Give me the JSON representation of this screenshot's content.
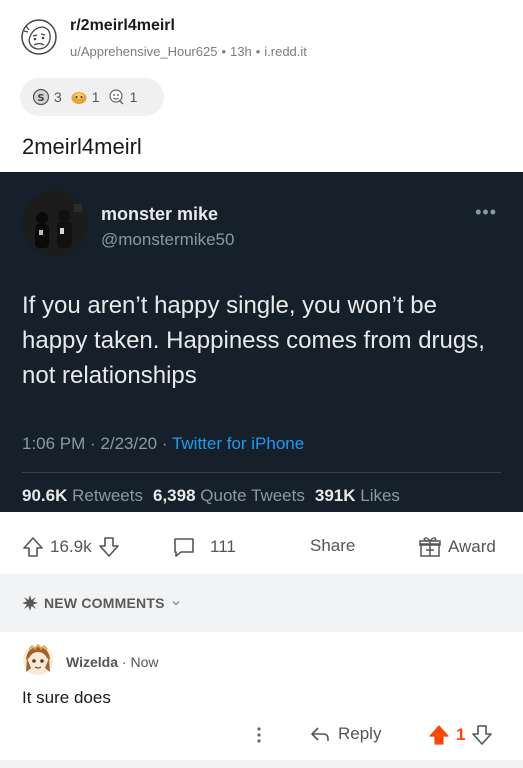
{
  "post": {
    "subreddit": "r/2meirl4meirl",
    "author": "u/Apprehensive_Hour625",
    "time": "13h",
    "domain": "i.redd.it",
    "awards": [
      {
        "icon": "silver-award-icon",
        "count": "3"
      },
      {
        "icon": "helpful-award-icon",
        "count": "1"
      },
      {
        "icon": "wholesome-award-icon",
        "count": "1"
      }
    ],
    "title": "2meirl4meirl"
  },
  "tweet": {
    "name": "monster mike",
    "handle": "@monstermike50",
    "more": "•••",
    "text": "If you aren’t happy single, you won’t be happy taken. Happiness comes from drugs, not relationships",
    "time": "1:06 PM · 2/23/20 · ",
    "source": "Twitter for iPhone",
    "retweets_count": "90.6K",
    "retweets_label": "Retweets",
    "quotes_count": "6,398",
    "quotes_label": "Quote Tweets",
    "likes_count": "391K",
    "likes_label": "Likes"
  },
  "actions": {
    "upvotes": "16.9k",
    "comments": "111",
    "share": "Share",
    "award": "Award"
  },
  "comments_section": {
    "header": "NEW COMMENTS"
  },
  "comment": {
    "author": "Wizelda",
    "time": "Now",
    "body": "It sure does",
    "reply": "Reply",
    "score": "1"
  },
  "colors": {
    "tweet_bg": "#15202b",
    "twitter_blue": "#1d9bf0",
    "upvote_orange": "#ff4500"
  }
}
